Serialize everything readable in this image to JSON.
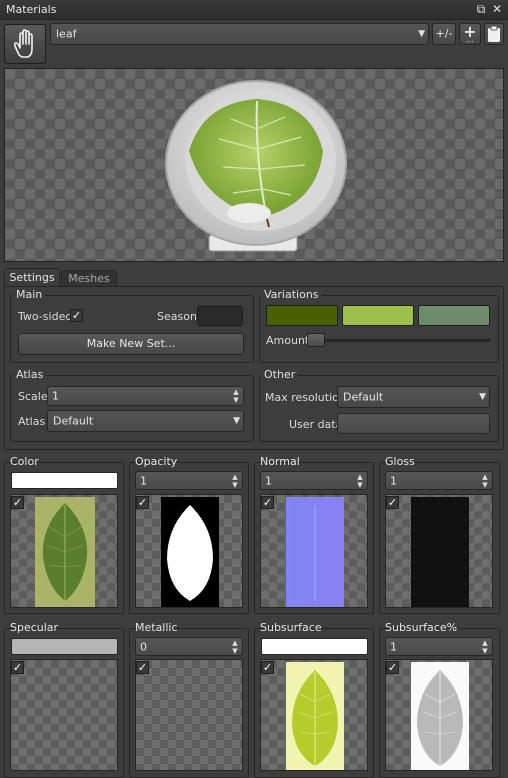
{
  "window": {
    "title": "Materials"
  },
  "toolbar": {
    "material_name": "leaf",
    "plusminus_label": "+/-",
    "add_label": "+",
    "add_sub": "..."
  },
  "tabs": [
    {
      "label": "Settings",
      "active": true
    },
    {
      "label": "Meshes",
      "active": false
    }
  ],
  "main": {
    "title": "Main",
    "two_sided_label": "Two-sided",
    "two_sided_checked": true,
    "season_label": "Season",
    "season_color": "#2a2a2a",
    "make_new_set_label": "Make New Set..."
  },
  "variations": {
    "title": "Variations",
    "colors": [
      "#476100",
      "#9cc04a",
      "#6d8a6a"
    ],
    "amount_label": "Amount",
    "amount_value": 0
  },
  "atlas": {
    "title": "Atlas",
    "scale_label": "Scale",
    "scale_value": "1",
    "atlas_label": "Atlas",
    "atlas_value": "Default"
  },
  "other": {
    "title": "Other",
    "max_resolution_label": "Max resolution",
    "max_resolution_value": "Default",
    "user_data_label": "User data",
    "user_data_value": ""
  },
  "slots": [
    {
      "label": "Color",
      "kind": "color",
      "swatch": "#ffffff",
      "checked": true,
      "texture": "leaf-color"
    },
    {
      "label": "Opacity",
      "kind": "value",
      "value": "1",
      "checked": true,
      "texture": "leaf-opacity"
    },
    {
      "label": "Normal",
      "kind": "value",
      "value": "1",
      "checked": true,
      "texture": "leaf-normal"
    },
    {
      "label": "Gloss",
      "kind": "value",
      "value": "1",
      "checked": true,
      "texture": "leaf-gloss"
    },
    {
      "label": "Specular",
      "kind": "color",
      "swatch": "#b4b4b4",
      "checked": true,
      "texture": "none"
    },
    {
      "label": "Metallic",
      "kind": "value",
      "value": "0",
      "checked": true,
      "texture": "none"
    },
    {
      "label": "Subsurface",
      "kind": "color",
      "swatch": "#ffffff",
      "checked": true,
      "texture": "leaf-subsurface"
    },
    {
      "label": "Subsurface%",
      "kind": "value",
      "value": "1",
      "checked": true,
      "texture": "leaf-subsurface-pct"
    }
  ],
  "icons": {
    "hand": "hand-icon",
    "restore": "restore-icon",
    "close": "close-icon",
    "clipboard": "clipboard-icon",
    "check": "check-icon"
  }
}
